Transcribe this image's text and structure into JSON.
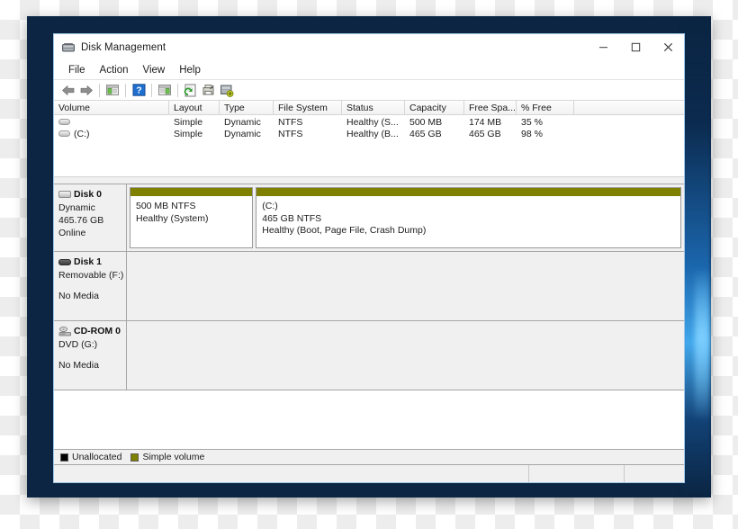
{
  "window": {
    "title": "Disk Management",
    "icon": "disk-management-icon",
    "controls": {
      "minimize": "–",
      "maximize": "☐",
      "close": "✕"
    }
  },
  "menubar": {
    "items": [
      {
        "label": "File"
      },
      {
        "label": "Action"
      },
      {
        "label": "View"
      },
      {
        "label": "Help"
      }
    ]
  },
  "toolbar": {
    "buttons": [
      {
        "name": "back-arrow-icon",
        "tip": "Back"
      },
      {
        "name": "forward-arrow-icon",
        "tip": "Forward"
      },
      {
        "name": "show-hide-console-tree-icon",
        "tip": "Show/Hide Console Tree"
      },
      {
        "name": "help-question-icon",
        "tip": "Help"
      },
      {
        "name": "show-hide-action-pane-icon",
        "tip": "Show/Hide Action Pane"
      },
      {
        "name": "rescan-disks-icon",
        "tip": "Rescan Disks"
      },
      {
        "name": "properties-icon",
        "tip": "Properties"
      },
      {
        "name": "create-vhd-icon",
        "tip": "Create VHD"
      }
    ]
  },
  "volume_list": {
    "columns": [
      "Volume",
      "Layout",
      "Type",
      "File System",
      "Status",
      "Capacity",
      "Free Spa...",
      "% Free",
      ""
    ],
    "rows": [
      {
        "volume": "",
        "layout": "Simple",
        "type": "Dynamic",
        "file_system": "NTFS",
        "status": "Healthy (S...",
        "capacity": "500 MB",
        "free_space": "174 MB",
        "percent_free": "35 %",
        "extra": ""
      },
      {
        "volume": "(C:)",
        "layout": "Simple",
        "type": "Dynamic",
        "file_system": "NTFS",
        "status": "Healthy (B...",
        "capacity": "465 GB",
        "free_space": "465 GB",
        "percent_free": "98 %",
        "extra": ""
      }
    ]
  },
  "disks": [
    {
      "name": "Disk 0",
      "icon": "fixed-disk-icon",
      "line1": "Dynamic",
      "line2": "465.76 GB",
      "line3": "Online",
      "partitions": [
        {
          "label": "",
          "size": "500 MB NTFS",
          "status": "Healthy (System)",
          "color": "#808000",
          "width_pct": 23
        },
        {
          "label": "(C:)",
          "size": "465  GB NTFS",
          "status": "Healthy (Boot, Page File, Crash Dump)",
          "color": "#808000",
          "width_pct": 77
        }
      ]
    },
    {
      "name": "Disk 1",
      "icon": "removable-disk-icon",
      "line1": "Removable (F:)",
      "line2": "",
      "line3": "No Media",
      "partitions": []
    },
    {
      "name": "CD-ROM 0",
      "icon": "cdrom-icon",
      "line1": "DVD (G:)",
      "line2": "",
      "line3": "No Media",
      "partitions": []
    }
  ],
  "legend": [
    {
      "label": "Unallocated",
      "color": "#000000"
    },
    {
      "label": "Simple volume",
      "color": "#808000"
    }
  ],
  "statusbar": {
    "pane1": "",
    "pane2": "",
    "pane3": ""
  },
  "colors": {
    "accent_volume": "#808000",
    "window_border": "#9dc6e8",
    "desktop": "#0b2542",
    "pane_bg": "#f0f0f0"
  }
}
